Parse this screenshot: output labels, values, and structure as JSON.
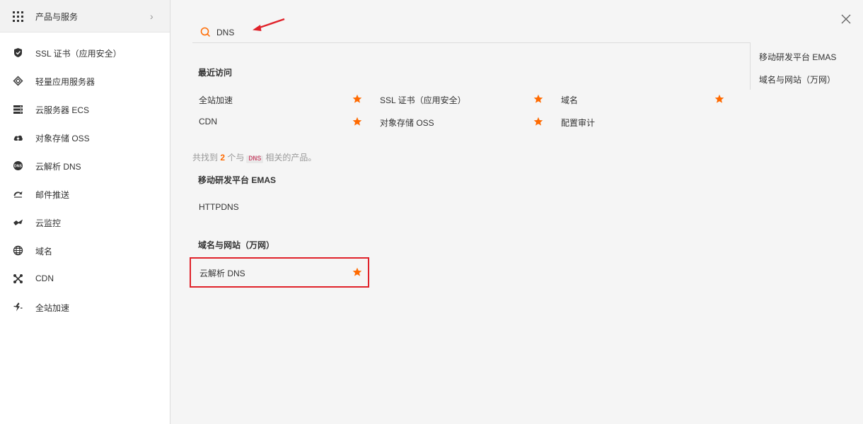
{
  "sidebar": {
    "header_label": "产品与服务",
    "items": [
      {
        "label": "SSL 证书（应用安全）",
        "icon": "shield-icon"
      },
      {
        "label": "轻量应用服务器",
        "icon": "layers-icon"
      },
      {
        "label": "云服务器 ECS",
        "icon": "server-icon"
      },
      {
        "label": "对象存储 OSS",
        "icon": "cloud-upload-icon"
      },
      {
        "label": "云解析 DNS",
        "icon": "dns-icon"
      },
      {
        "label": "邮件推送",
        "icon": "mail-send-icon"
      },
      {
        "label": "云监控",
        "icon": "monitor-icon"
      },
      {
        "label": "域名",
        "icon": "globe-icon"
      },
      {
        "label": "CDN",
        "icon": "cdn-icon"
      },
      {
        "label": "全站加速",
        "icon": "accelerate-icon"
      }
    ]
  },
  "search": {
    "value": "DNS"
  },
  "recent": {
    "title": "最近访问",
    "items": [
      {
        "label": "全站加速",
        "starred": true
      },
      {
        "label": "SSL 证书（应用安全）",
        "starred": true
      },
      {
        "label": "域名",
        "starred": true
      },
      {
        "label": "CDN",
        "starred": true
      },
      {
        "label": "对象存储 OSS",
        "starred": true
      },
      {
        "label": "配置审计",
        "starred": false
      }
    ]
  },
  "results": {
    "prefix": "共找到",
    "count": "2",
    "mid": "个与",
    "keyword": "DNS",
    "suffix": "相关的产品。",
    "groups": [
      {
        "title": "移动研发平台 EMAS",
        "items": [
          {
            "label": "HTTPDNS",
            "starred": false
          }
        ]
      },
      {
        "title": "域名与网站（万网）",
        "items": [
          {
            "label": "云解析 DNS",
            "starred": true
          }
        ]
      }
    ]
  },
  "right_panel": {
    "items": [
      "移动研发平台 EMAS",
      "域名与网站（万网）"
    ]
  },
  "colors": {
    "accent": "#ff6a00",
    "highlight_border": "#e0222a",
    "arrow": "#e0222a"
  }
}
